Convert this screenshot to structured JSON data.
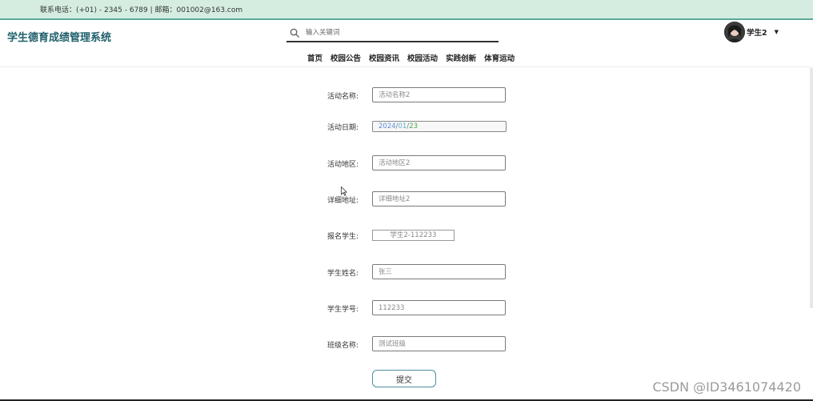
{
  "topbar": {
    "contact": "联系电话：(+01) - 2345 - 6789 | 邮箱：001002@163.com"
  },
  "header": {
    "logo": "学生德育成绩管理系统",
    "search": {
      "placeholder": "输入关键词",
      "icon": "search-icon"
    },
    "user": {
      "name": "学生2",
      "caret": "▼",
      "avatar_icon": "avatar"
    }
  },
  "nav": {
    "items": [
      "首页",
      "校园公告",
      "校园资讯",
      "校园活动",
      "实践创新",
      "体育运动"
    ]
  },
  "form": {
    "activity_name": {
      "label": "活动名称:",
      "placeholder": "活动名称2"
    },
    "activity_date": {
      "label": "活动日期:",
      "year": "2024",
      "month": "01",
      "day": "23",
      "sep": "/"
    },
    "activity_area": {
      "label": "活动地区:",
      "placeholder": "活动地区2"
    },
    "address": {
      "label": "详细地址:",
      "placeholder": "详细地址2"
    },
    "enrolled_student": {
      "label": "报名学生:",
      "value": "学生2-112233"
    },
    "student_name": {
      "label": "学生姓名:",
      "placeholder": "张三"
    },
    "student_id": {
      "label": "学生学号:",
      "placeholder": "112233"
    },
    "class_name": {
      "label": "班级名称:",
      "placeholder": "测试班级"
    },
    "submit_label": "提交"
  },
  "watermark": "CSDN @ID3461074420",
  "colors": {
    "topbar_bg": "#d5ede1",
    "accent": "#5aa89a",
    "logo": "#1f5f6b"
  }
}
